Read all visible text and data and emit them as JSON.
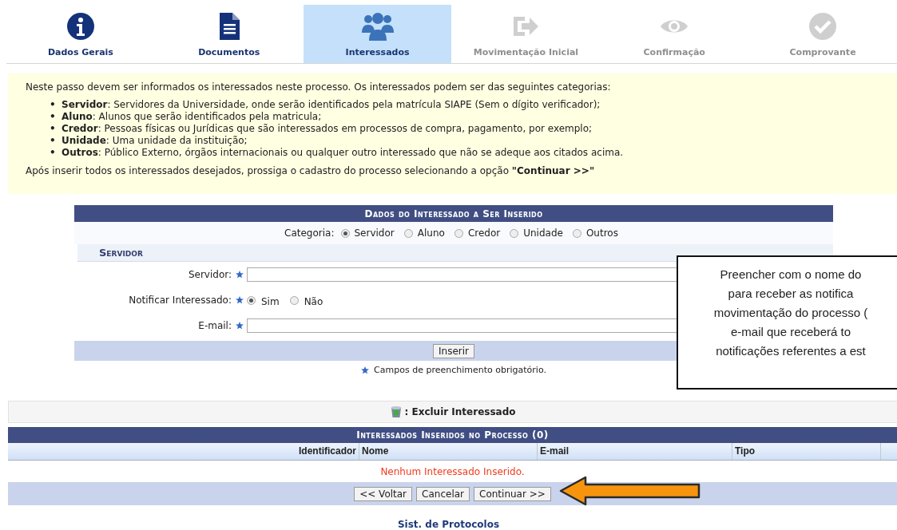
{
  "steps": [
    {
      "label": "Dados Gerais",
      "kind": "info",
      "selected": false,
      "disabled": false
    },
    {
      "label": "Documentos",
      "kind": "document",
      "selected": false,
      "disabled": false
    },
    {
      "label": "Interessados",
      "kind": "people",
      "selected": true,
      "disabled": false
    },
    {
      "label": "Movimentação Inicial",
      "kind": "exit",
      "selected": false,
      "disabled": true
    },
    {
      "label": "Confirmação",
      "kind": "eye",
      "selected": false,
      "disabled": true
    },
    {
      "label": "Comprovante",
      "kind": "check",
      "selected": false,
      "disabled": true
    }
  ],
  "intro": {
    "text": "Neste passo devem ser informados os interessados neste processo. Os interessados podem ser das seguintes categorias:",
    "items": [
      {
        "marker": "•",
        "text": "**Servidor**: Servidores da Universidade, onde serão identificados pela matrícula SIAPE (Sem o dígito verificador);"
      },
      {
        "marker": "•",
        "text": "**Aluno**: Alunos que serão identificados pela matricula;"
      },
      {
        "marker": "•",
        "text": "**Credor**: Pessoas físicas ou Jurídicas que são interessados em processos de compra, pagamento, por exemplo;"
      },
      {
        "marker": "•",
        "text": "**Unidade**: Uma unidade da instituição;"
      },
      {
        "marker": "•",
        "text": "**Outros**: Público Externo, órgãos internacionais ou qualquer outro interessado que não se adeque aos citados acima."
      }
    ],
    "footer": "Após inserir todos os interessados desejados, prossiga o cadastro do processo selecionando a opção **\"Continuar >>\"**"
  },
  "form": {
    "title": "Dados do Interessado a Ser Inserido",
    "category": {
      "label": "Categoria:",
      "options": [
        {
          "label": "Servidor",
          "selected": true
        },
        {
          "label": "Aluno",
          "selected": false
        },
        {
          "label": "Credor",
          "selected": false
        },
        {
          "label": "Unidade",
          "selected": false
        },
        {
          "label": "Outros",
          "selected": false
        }
      ]
    },
    "section_title": "Servidor",
    "fields": [
      {
        "kind": "text",
        "label": "Servidor:",
        "required": true
      },
      {
        "kind": "radio",
        "label": "Notificar Interessado:",
        "required": true,
        "options": [
          {
            "label": "Sim",
            "selected": true
          },
          {
            "label": "Não",
            "selected": false
          }
        ]
      },
      {
        "kind": "text",
        "label": "E-mail:",
        "required": true
      }
    ],
    "button": "Inserir",
    "note": "Campos de preenchimento obrigatório."
  },
  "callout": {
    "lines": [
      "Preencher com o nome do",
      "para receber as notifica",
      "movimentação do processo (",
      "e-mail que receberá to",
      "notificações referentes a est"
    ]
  },
  "legend": {
    "label": ": Excluir Interessado"
  },
  "list_table": {
    "title": "Interessados Inseridos no Processo (0)",
    "columns": [
      "Identificador",
      "Nome",
      "E-mail",
      "Tipo"
    ],
    "empty_message": "Nenhum Interessado Inserido.",
    "buttons": [
      "<< Voltar",
      "Cancelar",
      "Continuar >>"
    ]
  },
  "footer": "Sist. de Protocolos"
}
